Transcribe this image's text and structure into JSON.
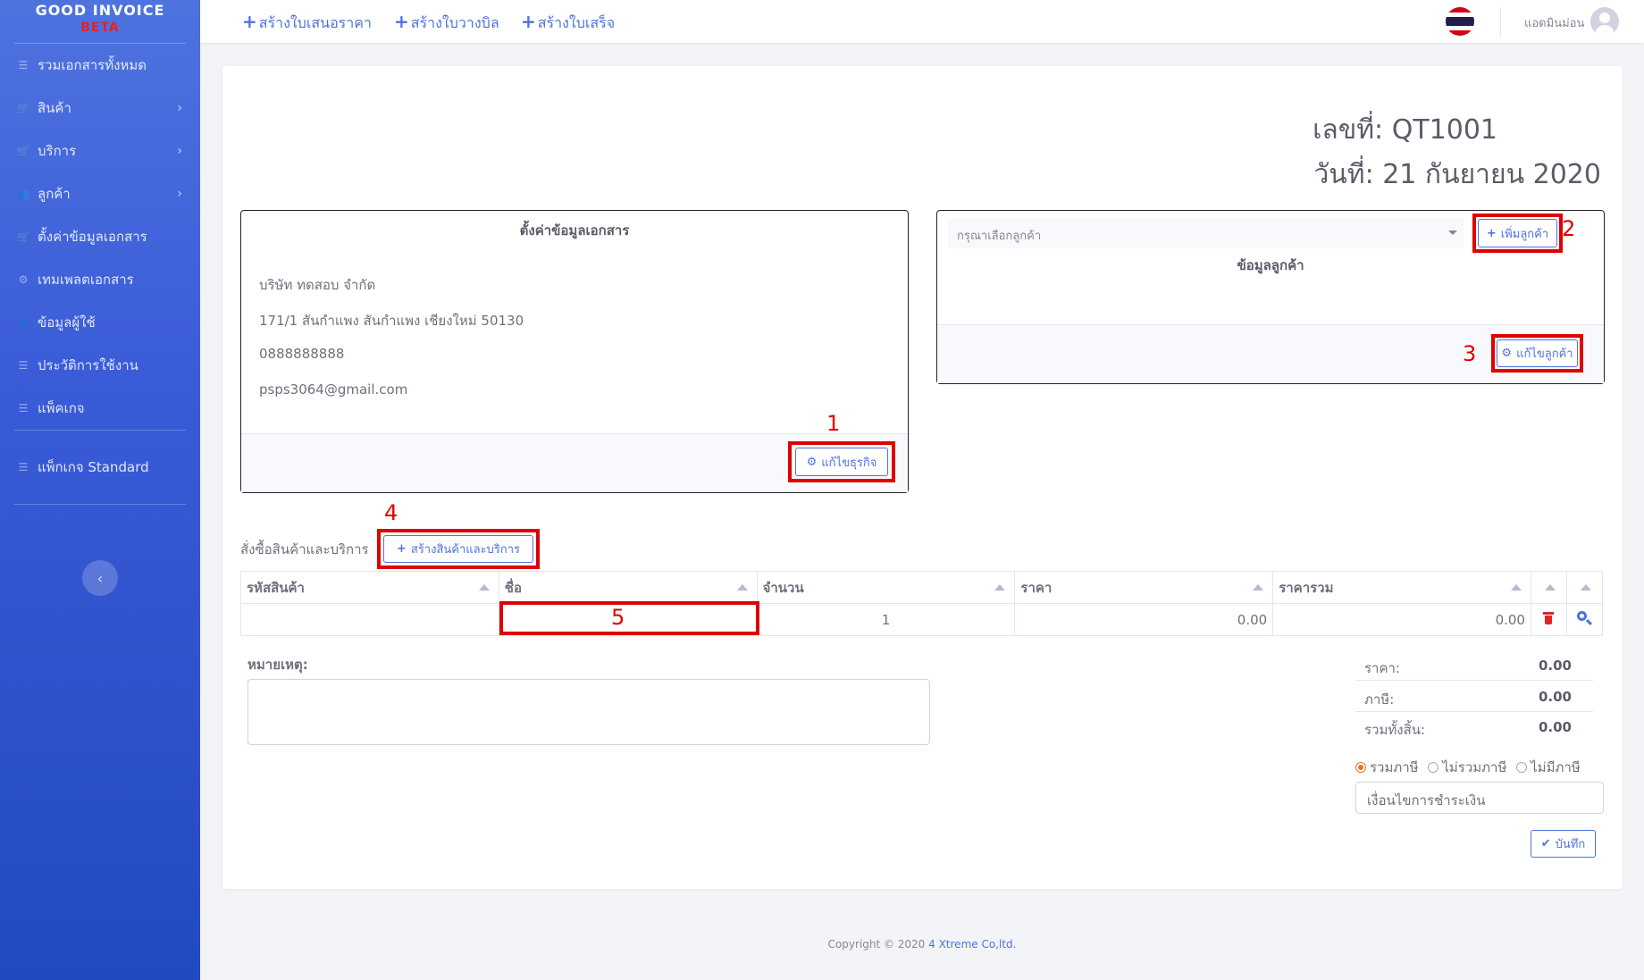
{
  "sidebar": {
    "brand": "GOOD INVOICE",
    "brand_badge": "BETA",
    "items": [
      {
        "label": "รวมเอกสารทั้งหมด",
        "icon": "list-icon"
      },
      {
        "label": "สินค้า",
        "icon": "cart-icon"
      },
      {
        "label": "บริการ",
        "icon": "cart-icon"
      },
      {
        "label": "ลูกค้า",
        "icon": "users-icon"
      },
      {
        "label": "ตั้งค่าข้อมูลเอกสาร",
        "icon": "cart-icon"
      },
      {
        "label": "เทมเพลตเอกสาร",
        "icon": "gear-icon"
      },
      {
        "label": "ข้อมูลผู้ใช้",
        "icon": "user-icon"
      },
      {
        "label": "ประวัติการใช้งาน",
        "icon": "list-icon"
      },
      {
        "label": "แพ็คเกจ",
        "icon": "list-icon"
      },
      {
        "label": "แพ็กเกจ Standard",
        "icon": "list-icon"
      }
    ],
    "toggle_icon": "‹"
  },
  "topbar": {
    "links": [
      "สร้างใบเสนอราคา",
      "สร้างใบวางบิล",
      "สร้างใบเสร็จ"
    ],
    "user_name": "แอดมินม่อน"
  },
  "document": {
    "number_label": "เลขที่: QT1001",
    "date_label": "วันที่: 21 กันยายน 2020"
  },
  "business": {
    "title": "ตั้งค่าข้อมูลเอกสาร",
    "lines": [
      "บริษัท ทดสอบ จำกัด",
      "171/1 สันกำแพง สันกำแพง เชียงใหม่ 50130",
      "0888888888",
      "psps3064@gmail.com"
    ],
    "edit_button": "แก้ไขธุรกิจ"
  },
  "customer": {
    "select_placeholder": "กรุณาเลือกลูกค้า",
    "add_button": "เพิ่มลูกค้า",
    "title": "ข้อมูลลูกค้า",
    "edit_button": "แก้ไขลูกค้า"
  },
  "annotations": [
    "1",
    "2",
    "3",
    "4",
    "5"
  ],
  "order": {
    "label": "สั่งซื้อสินค้าและบริการ",
    "create_button": "สร้างสินค้าและบริการ",
    "columns": [
      "รหัสสินค้า",
      "ชื่อ",
      "จำนวน",
      "ราคา",
      "ราคารวม",
      "",
      ""
    ],
    "row": {
      "code": "",
      "name": "",
      "qty": "1",
      "price": "0.00",
      "total": "0.00"
    }
  },
  "note": {
    "label": "หมายเหตุ:"
  },
  "summary": [
    {
      "label": "ราคา:",
      "value": "0.00"
    },
    {
      "label": "ภาษี:",
      "value": "0.00"
    },
    {
      "label": "รวมทั้งสิ้น:",
      "value": "0.00"
    }
  ],
  "tax_options": [
    {
      "label": "รวมภาษี",
      "selected": true
    },
    {
      "label": "ไม่รวมภาษี",
      "selected": false
    },
    {
      "label": "ไม่มีภาษี",
      "selected": false
    }
  ],
  "payment": {
    "placeholder": "เงื่อนไขการชำระเงิน"
  },
  "save_button": "บันทึก",
  "footer": {
    "text": "Copyright © 2020 ",
    "company": "4 Xtreme Co,ltd."
  },
  "colors": {
    "primary": "#4e73df",
    "annotation": "#e00000",
    "danger": "#e02424"
  }
}
